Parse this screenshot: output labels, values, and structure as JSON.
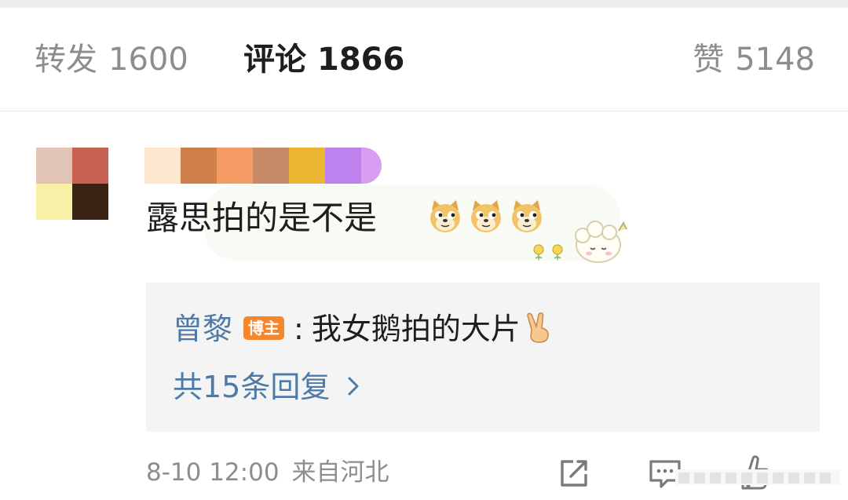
{
  "tabs": {
    "repost": {
      "label": "转发",
      "count": "1600"
    },
    "comment": {
      "label": "评论",
      "count": "1866"
    },
    "like": {
      "label": "赞",
      "count": "5148"
    }
  },
  "comment": {
    "text": "露思拍的是不是",
    "emojis": [
      "doge-icon",
      "doge-icon",
      "doge-icon"
    ]
  },
  "reply": {
    "user": "曾黎",
    "badge": "博主",
    "colon": ":",
    "text": "我女鹅拍的大片",
    "more_label": "共15条回复"
  },
  "footer": {
    "time": "8-10 12:00",
    "location": "来自河北"
  },
  "colors": {
    "link_blue": "#4e7aa8",
    "badge_orange": "#f6862c",
    "muted_text": "#8d8d8d",
    "reply_bg": "#f4f4f4"
  }
}
